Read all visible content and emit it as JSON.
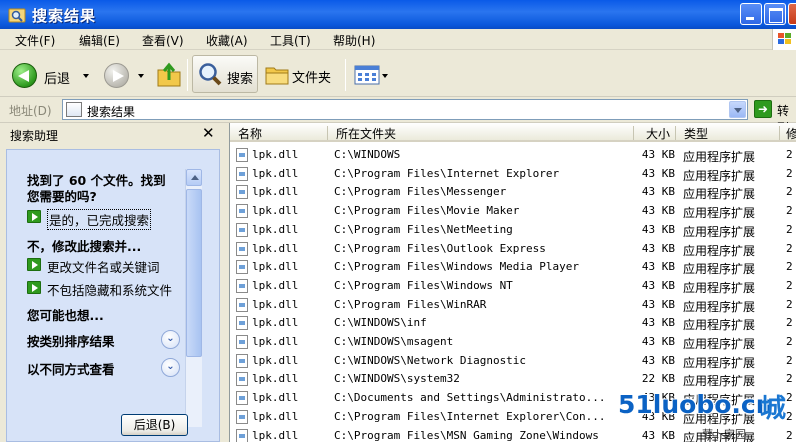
{
  "window": {
    "title": "搜索结果",
    "icon": "search-results-folder-icon"
  },
  "menu": {
    "items": [
      "文件(F)",
      "编辑(E)",
      "查看(V)",
      "收藏(A)",
      "工具(T)",
      "帮助(H)"
    ]
  },
  "toolbar": {
    "back_label": "后退",
    "search_label": "搜索",
    "folders_label": "文件夹"
  },
  "address": {
    "label": "地址(D)",
    "value": "搜索结果",
    "go_label": "转到"
  },
  "search_pane": {
    "title": "搜索助理",
    "found_text_1": "找到了 60 个文件。找到",
    "found_text_2": "您需要的吗?",
    "yes_done": "是的，已完成搜索",
    "no_refine": "不，修改此搜索并...",
    "change_name": "更改文件名或关键词",
    "exclude_hidden": "不包括隐藏和系统文件",
    "also_want": "您可能也想...",
    "sort_by_category": "按类别排序结果",
    "view_different": "以不同方式查看",
    "back_button": "后退(B)"
  },
  "columns": {
    "name": "名称",
    "folder": "所在文件夹",
    "size": "大小",
    "type": "类型",
    "date": "修"
  },
  "files": [
    {
      "name": "lpk.dll",
      "folder": "C:\\WINDOWS",
      "size": "43 KB",
      "type": "应用程序扩展",
      "date": "2"
    },
    {
      "name": "lpk.dll",
      "folder": "C:\\Program Files\\Internet Explorer",
      "size": "43 KB",
      "type": "应用程序扩展",
      "date": "2"
    },
    {
      "name": "lpk.dll",
      "folder": "C:\\Program Files\\Messenger",
      "size": "43 KB",
      "type": "应用程序扩展",
      "date": "2"
    },
    {
      "name": "lpk.dll",
      "folder": "C:\\Program Files\\Movie Maker",
      "size": "43 KB",
      "type": "应用程序扩展",
      "date": "2"
    },
    {
      "name": "lpk.dll",
      "folder": "C:\\Program Files\\NetMeeting",
      "size": "43 KB",
      "type": "应用程序扩展",
      "date": "2"
    },
    {
      "name": "lpk.dll",
      "folder": "C:\\Program Files\\Outlook Express",
      "size": "43 KB",
      "type": "应用程序扩展",
      "date": "2"
    },
    {
      "name": "lpk.dll",
      "folder": "C:\\Program Files\\Windows Media Player",
      "size": "43 KB",
      "type": "应用程序扩展",
      "date": "2"
    },
    {
      "name": "lpk.dll",
      "folder": "C:\\Program Files\\Windows NT",
      "size": "43 KB",
      "type": "应用程序扩展",
      "date": "2"
    },
    {
      "name": "lpk.dll",
      "folder": "C:\\Program Files\\WinRAR",
      "size": "43 KB",
      "type": "应用程序扩展",
      "date": "2"
    },
    {
      "name": "lpk.dll",
      "folder": "C:\\WINDOWS\\inf",
      "size": "43 KB",
      "type": "应用程序扩展",
      "date": "2"
    },
    {
      "name": "lpk.dll",
      "folder": "C:\\WINDOWS\\msagent",
      "size": "43 KB",
      "type": "应用程序扩展",
      "date": "2"
    },
    {
      "name": "lpk.dll",
      "folder": "C:\\WINDOWS\\Network Diagnostic",
      "size": "43 KB",
      "type": "应用程序扩展",
      "date": "2"
    },
    {
      "name": "lpk.dll",
      "folder": "C:\\WINDOWS\\system32",
      "size": "22 KB",
      "type": "应用程序扩展",
      "date": "2"
    },
    {
      "name": "lpk.dll",
      "folder": "C:\\Documents and Settings\\Administrato...",
      "size": "43 KB",
      "type": "应用程序扩展",
      "date": "2"
    },
    {
      "name": "lpk.dll",
      "folder": "C:\\Program Files\\Internet Explorer\\Con...",
      "size": "43 KB",
      "type": "应用程序扩展",
      "date": "2"
    },
    {
      "name": "lpk.dll",
      "folder": "C:\\Program Files\\MSN Gaming Zone\\Windows",
      "size": "43 KB",
      "type": "应用程序扩展",
      "date": "2"
    }
  ],
  "watermark": {
    "text": "51luobo.cn",
    "cn": "城",
    "sub": "萝卜家园"
  }
}
